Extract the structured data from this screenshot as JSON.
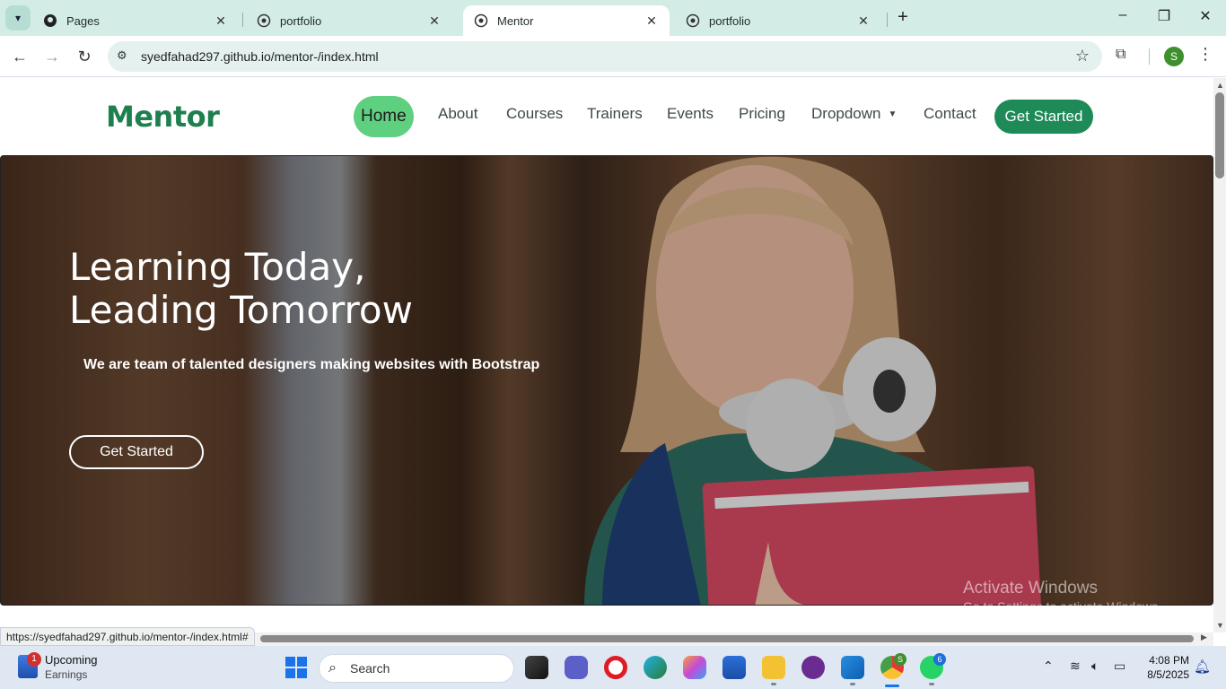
{
  "browser": {
    "tabs": [
      {
        "title": "Pages",
        "icon": "github-icon"
      },
      {
        "title": "portfolio",
        "icon": "globe-icon"
      },
      {
        "title": "Mentor",
        "icon": "globe-icon",
        "active": true
      },
      {
        "title": "portfolio",
        "icon": "globe-icon"
      }
    ],
    "url": "syedfahad297.github.io/mentor-/index.html",
    "profile_initial": "S",
    "status_url": "https://syedfahad297.github.io/mentor-/index.html#"
  },
  "site": {
    "logo": "Mentor",
    "nav": {
      "home": "Home",
      "about": "About",
      "courses": "Courses",
      "trainers": "Trainers",
      "events": "Events",
      "pricing": "Pricing",
      "dropdown": "Dropdown",
      "contact": "Contact",
      "cta": "Get Started"
    },
    "hero": {
      "title_line1": "Learning Today,",
      "title_line2": "Leading Tomorrow",
      "subtitle": "We are team of talented designers making websites with Bootstrap",
      "button": "Get Started"
    },
    "accent_color": "#1d8a57",
    "active_nav_color": "#5fcf80"
  },
  "watermark": {
    "title": "Activate Windows",
    "subtitle": "Go to Settings to activate Windows."
  },
  "taskbar": {
    "widget_title": "Upcoming",
    "widget_sub": "Earnings",
    "widget_badge": "1",
    "search_label": "Search",
    "chrome_badge": "S",
    "whatsapp_badge": "6",
    "time": "4:08 PM",
    "date": "8/5/2025"
  }
}
